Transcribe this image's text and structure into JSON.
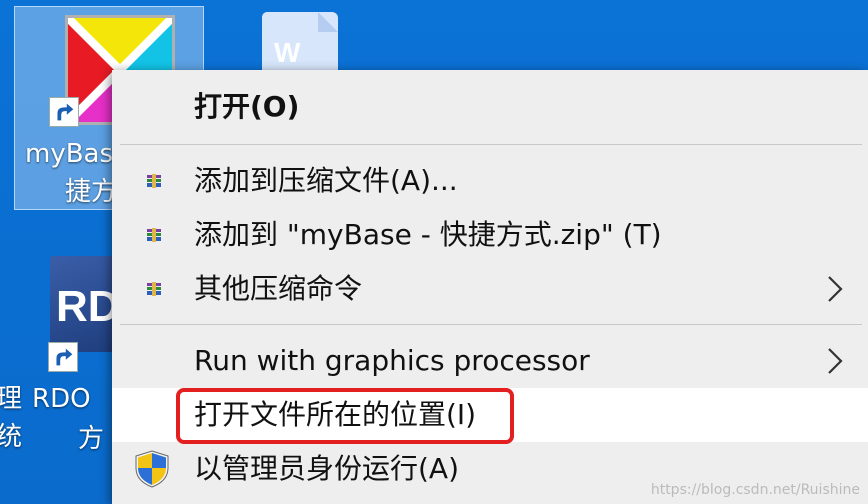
{
  "desktop": {
    "icons": [
      {
        "label_line1": "myBas",
        "label_line2": "捷方"
      },
      {
        "label_line1": "",
        "label_line2": ""
      },
      {
        "label_line1": "RDO",
        "label_line2": "方"
      }
    ],
    "partial_left_labels": [
      "理",
      "统"
    ],
    "rdo_letters": "RD"
  },
  "context_menu": {
    "items": [
      {
        "label": "打开(O)"
      },
      {
        "label": "添加到压缩文件(A)..."
      },
      {
        "label": "添加到 \"myBase - 快捷方式.zip\" (T)"
      },
      {
        "label": "其他压缩命令"
      },
      {
        "label": "Run with graphics processor"
      },
      {
        "label": "打开文件所在的位置(I)"
      },
      {
        "label": "以管理员身份运行(A)"
      }
    ]
  },
  "watermark": "https://blog.csdn.net/Ruishine",
  "colors": {
    "desktop_bg": "#0a6fd0",
    "menu_bg": "#eeeeee",
    "highlight_box": "#e41f1f"
  }
}
